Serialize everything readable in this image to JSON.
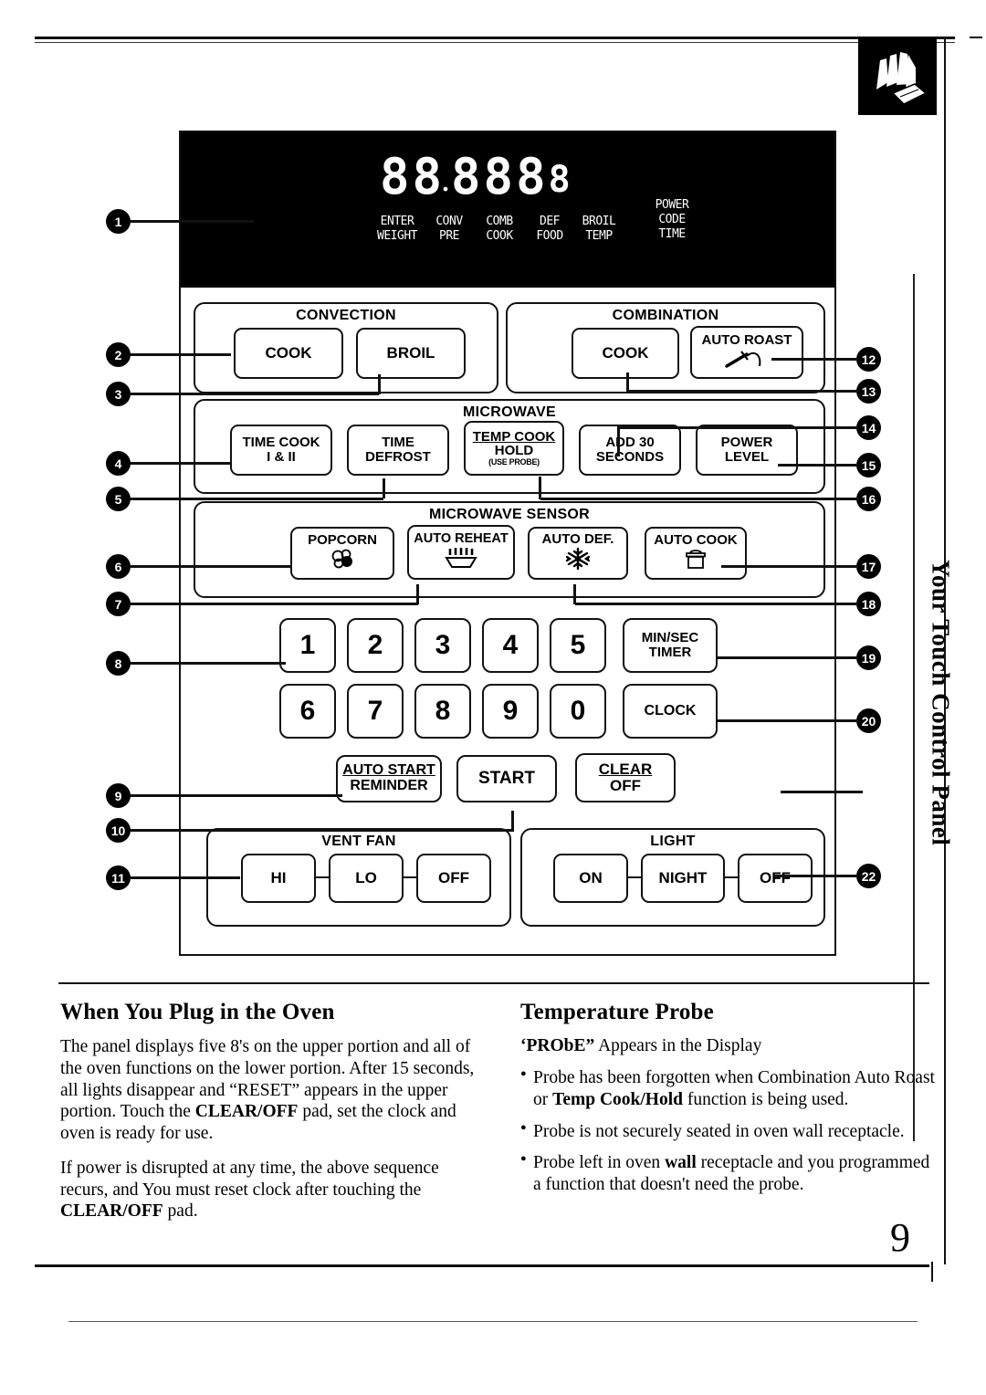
{
  "page": {
    "number": "9",
    "side_tab": "Your Touch Control Panel",
    "corner_icon": "hand-pressing-pad-icon"
  },
  "display": {
    "digits": [
      "8",
      "8",
      "8",
      "8",
      "8",
      "8"
    ],
    "decimal": ".",
    "labels": [
      {
        "top": "ENTER",
        "bottom": "WEIGHT"
      },
      {
        "top": "CONV",
        "bottom": "PRE"
      },
      {
        "top": "COMB",
        "bottom": "COOK"
      },
      {
        "top": "DEF",
        "bottom": "FOOD"
      },
      {
        "top": "BROIL",
        "bottom": "TEMP"
      }
    ],
    "power_label": {
      "l1": "POWER",
      "l2": "CODE",
      "l3": "TIME"
    }
  },
  "groups": {
    "convection": {
      "title": "CONVECTION",
      "buttons": [
        {
          "l1": "COOK",
          "icon": ""
        },
        {
          "l1": "BROIL",
          "icon": ""
        }
      ]
    },
    "combination": {
      "title": "COMBINATION",
      "buttons": [
        {
          "l1": "COOK",
          "icon": ""
        },
        {
          "l1": "AUTO ROAST",
          "icon": "temperature-probe-icon"
        }
      ]
    },
    "microwave": {
      "title": "MICROWAVE",
      "buttons": [
        {
          "l1": "TIME COOK",
          "l2": "I & II"
        },
        {
          "l1": "TIME",
          "l2": "DEFROST"
        },
        {
          "l1": "TEMP COOK",
          "l2": "HOLD",
          "l3": "(USE PROBE)"
        },
        {
          "l1": "ADD 30",
          "l2": "SECONDS"
        },
        {
          "l1": "POWER",
          "l2": "LEVEL"
        }
      ]
    },
    "microwave_sensor": {
      "title": "MICROWAVE SENSOR",
      "buttons": [
        {
          "l1": "POPCORN",
          "icon": "popcorn-icon"
        },
        {
          "l1": "AUTO REHEAT",
          "icon": "steaming-dish-icon"
        },
        {
          "l1": "AUTO DEF.",
          "icon": "snowflake-icon"
        },
        {
          "l1": "AUTO COOK",
          "icon": "covered-pot-icon"
        }
      ]
    },
    "vent_fan": {
      "title": "VENT FAN",
      "buttons": [
        {
          "l1": "HI"
        },
        {
          "l1": "LO"
        },
        {
          "l1": "OFF"
        }
      ]
    },
    "light": {
      "title": "LIGHT",
      "buttons": [
        {
          "l1": "ON"
        },
        {
          "l1": "NIGHT"
        },
        {
          "l1": "OFF"
        }
      ]
    }
  },
  "keypad": {
    "row1": [
      "1",
      "2",
      "3",
      "4",
      "5"
    ],
    "row2": [
      "6",
      "7",
      "8",
      "9",
      "0"
    ],
    "min_sec_timer": {
      "l1": "MIN/SEC",
      "l2": "TIMER"
    },
    "clock": {
      "l1": "CLOCK"
    }
  },
  "actions": {
    "auto_start": {
      "l1": "AUTO START",
      "l2": "REMINDER"
    },
    "start": {
      "l1": "START"
    },
    "clear_off": {
      "l1": "CLEAR",
      "l2": "OFF"
    }
  },
  "callouts": [
    "1",
    "2",
    "3",
    "4",
    "5",
    "6",
    "7",
    "8",
    "9",
    "10",
    "11",
    "12",
    "13",
    "14",
    "15",
    "16",
    "17",
    "18",
    "19",
    "20",
    "22"
  ],
  "text": {
    "left": {
      "heading": "When You Plug in the Oven",
      "p1_a": "The panel displays five 8's on the upper portion and all of the oven functions on the lower portion. After 15 seconds, all lights disappear and “RESET” appears in the upper portion. Touch the ",
      "p1_b": "CLEAR/OFF",
      "p1_c": " pad, set the clock and oven is ready for use.",
      "p2_a": "If power is disrupted at any time, the above sequence recurs, and You must reset clock after touching the ",
      "p2_b": "CLEAR/OFF",
      "p2_c": " pad."
    },
    "right": {
      "heading": "Temperature Probe",
      "sub_a": "‘PRObE”",
      "sub_b": " Appears in the Display",
      "b1_a": "Probe has been forgotten when Combination Auto Roast or ",
      "b1_b": "Temp Cook/Hold",
      "b1_c": " function is being used.",
      "b2": "Probe is not securely seated in oven wall receptacle.",
      "b3_a": "Probe left in oven ",
      "b3_b": "wall",
      "b3_c": " receptacle and you programmed a function that doesn't need the probe."
    }
  }
}
